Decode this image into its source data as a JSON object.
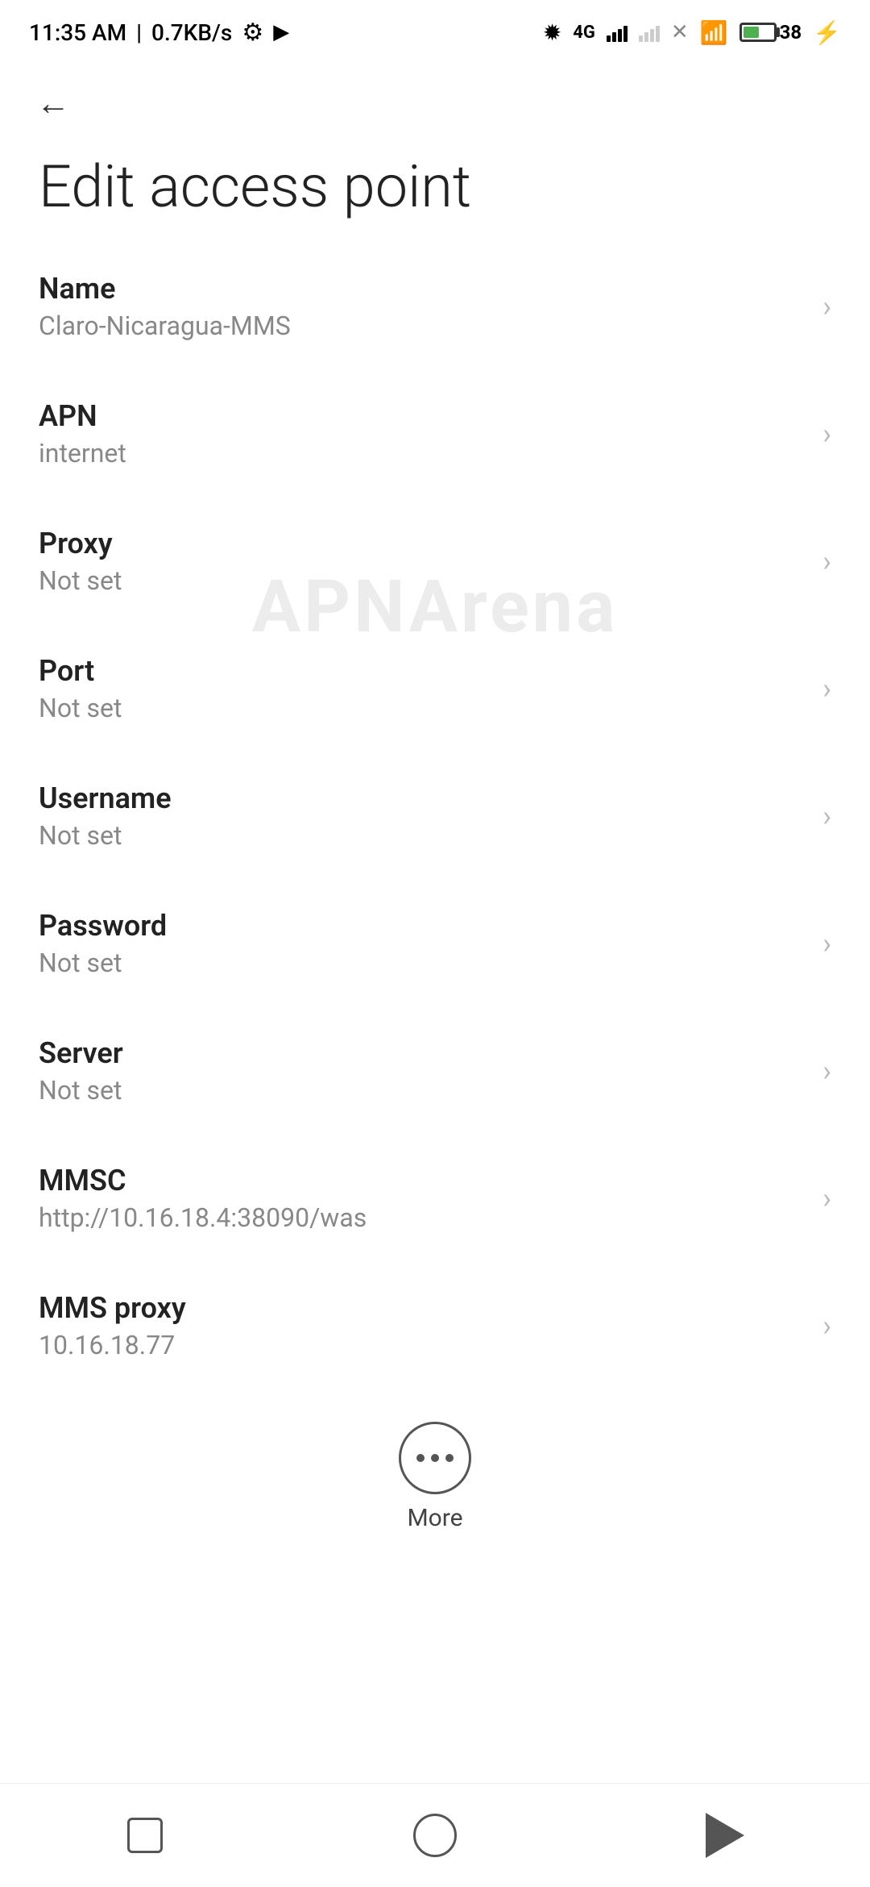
{
  "status_bar": {
    "time": "11:35 AM",
    "data_speed": "0.7KB/s"
  },
  "page": {
    "title": "Edit access point"
  },
  "back_button": {
    "label": "Back"
  },
  "settings_items": [
    {
      "id": "name",
      "title": "Name",
      "value": "Claro-Nicaragua-MMS"
    },
    {
      "id": "apn",
      "title": "APN",
      "value": "internet"
    },
    {
      "id": "proxy",
      "title": "Proxy",
      "value": "Not set"
    },
    {
      "id": "port",
      "title": "Port",
      "value": "Not set"
    },
    {
      "id": "username",
      "title": "Username",
      "value": "Not set"
    },
    {
      "id": "password",
      "title": "Password",
      "value": "Not set"
    },
    {
      "id": "server",
      "title": "Server",
      "value": "Not set"
    },
    {
      "id": "mmsc",
      "title": "MMSC",
      "value": "http://10.16.18.4:38090/was"
    },
    {
      "id": "mms_proxy",
      "title": "MMS proxy",
      "value": "10.16.18.77"
    }
  ],
  "more": {
    "label": "More"
  },
  "watermark": {
    "line1": "APNArena"
  }
}
